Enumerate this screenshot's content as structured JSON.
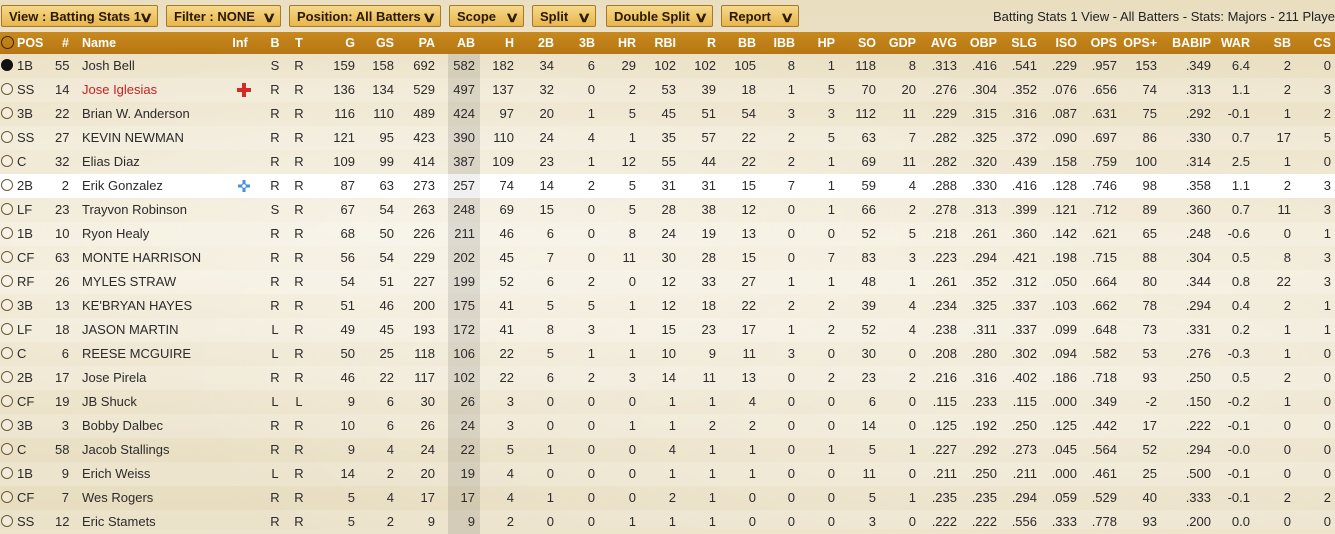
{
  "toolbar": {
    "view_label": "View : Batting Stats 1",
    "filter_label": "Filter : NONE",
    "position_label": "Position: All Batters",
    "scope_label": "Scope",
    "split_label": "Split",
    "double_split_label": "Double Split",
    "report_label": "Report",
    "info_text": "Batting Stats 1 View - All Batters - Stats: Majors - 211 Playe"
  },
  "columns": [
    "POS",
    "#",
    "Name",
    "Inf",
    "B",
    "T",
    "G",
    "GS",
    "PA",
    "AB",
    "H",
    "2B",
    "3B",
    "HR",
    "RBI",
    "R",
    "BB",
    "IBB",
    "HP",
    "SO",
    "GDP",
    "AVG",
    "OBP",
    "SLG",
    "ISO",
    "OPS",
    "OPS+",
    "BABIP",
    "WAR",
    "SB",
    "CS"
  ],
  "colors": {
    "header_bg": "#b97a16",
    "injury_text": "#cc1f1f",
    "injury_icon": "#d42a2a",
    "dtd_icon": "#4a90d9"
  },
  "rows": [
    {
      "selected_radio": true,
      "pos": "1B",
      "num": "55",
      "name": "Josh Bell",
      "inf": "",
      "b": "S",
      "t": "R",
      "g": "159",
      "gs": "158",
      "pa": "692",
      "ab": "582",
      "h": "182",
      "2b": "34",
      "3b": "6",
      "hr": "29",
      "rbi": "102",
      "r": "102",
      "bb": "105",
      "ibb": "8",
      "hp": "1",
      "so": "118",
      "gdp": "8",
      "avg": ".313",
      "obp": ".416",
      "slg": ".541",
      "iso": ".229",
      "ops": ".957",
      "opsp": "153",
      "babip": ".349",
      "war": "6.4",
      "sb": "2",
      "cs": "0"
    },
    {
      "pos": "SS",
      "num": "14",
      "name": "Jose Iglesias",
      "injured": true,
      "inf": "red-cross-icon",
      "b": "R",
      "t": "R",
      "g": "136",
      "gs": "134",
      "pa": "529",
      "ab": "497",
      "h": "137",
      "2b": "32",
      "3b": "0",
      "hr": "2",
      "rbi": "53",
      "r": "39",
      "bb": "18",
      "ibb": "1",
      "hp": "5",
      "so": "70",
      "gdp": "20",
      "avg": ".276",
      "obp": ".304",
      "slg": ".352",
      "iso": ".076",
      "ops": ".656",
      "opsp": "74",
      "babip": ".313",
      "war": "1.1",
      "sb": "2",
      "cs": "3"
    },
    {
      "pos": "3B",
      "num": "22",
      "name": "Brian W. Anderson",
      "inf": "",
      "b": "R",
      "t": "R",
      "g": "116",
      "gs": "110",
      "pa": "489",
      "ab": "424",
      "h": "97",
      "2b": "20",
      "3b": "1",
      "hr": "5",
      "rbi": "45",
      "r": "51",
      "bb": "54",
      "ibb": "3",
      "hp": "3",
      "so": "112",
      "gdp": "11",
      "avg": ".229",
      "obp": ".315",
      "slg": ".316",
      "iso": ".087",
      "ops": ".631",
      "opsp": "75",
      "babip": ".292",
      "war": "-0.1",
      "sb": "1",
      "cs": "2"
    },
    {
      "pos": "SS",
      "num": "27",
      "name": "KEVIN NEWMAN",
      "inf": "",
      "b": "R",
      "t": "R",
      "g": "121",
      "gs": "95",
      "pa": "423",
      "ab": "390",
      "h": "110",
      "2b": "24",
      "3b": "4",
      "hr": "1",
      "rbi": "35",
      "r": "57",
      "bb": "22",
      "ibb": "2",
      "hp": "5",
      "so": "63",
      "gdp": "7",
      "avg": ".282",
      "obp": ".325",
      "slg": ".372",
      "iso": ".090",
      "ops": ".697",
      "opsp": "86",
      "babip": ".330",
      "war": "0.7",
      "sb": "17",
      "cs": "5"
    },
    {
      "pos": "C",
      "num": "32",
      "name": "Elias Diaz",
      "inf": "",
      "b": "R",
      "t": "R",
      "g": "109",
      "gs": "99",
      "pa": "414",
      "ab": "387",
      "h": "109",
      "2b": "23",
      "3b": "1",
      "hr": "12",
      "rbi": "55",
      "r": "44",
      "bb": "22",
      "ibb": "2",
      "hp": "1",
      "so": "69",
      "gdp": "11",
      "avg": ".282",
      "obp": ".320",
      "slg": ".439",
      "iso": ".158",
      "ops": ".759",
      "opsp": "100",
      "babip": ".314",
      "war": "2.5",
      "sb": "1",
      "cs": "0"
    },
    {
      "selected": true,
      "pos": "2B",
      "num": "2",
      "name": "Erik Gonzalez",
      "inf": "blue-cross-icon",
      "b": "R",
      "t": "R",
      "g": "87",
      "gs": "63",
      "pa": "273",
      "ab": "257",
      "h": "74",
      "2b": "14",
      "3b": "2",
      "hr": "5",
      "rbi": "31",
      "r": "31",
      "bb": "15",
      "ibb": "7",
      "hp": "1",
      "so": "59",
      "gdp": "4",
      "avg": ".288",
      "obp": ".330",
      "slg": ".416",
      "iso": ".128",
      "ops": ".746",
      "opsp": "98",
      "babip": ".358",
      "war": "1.1",
      "sb": "2",
      "cs": "3"
    },
    {
      "pos": "LF",
      "num": "23",
      "name": "Trayvon Robinson",
      "inf": "",
      "b": "S",
      "t": "R",
      "g": "67",
      "gs": "54",
      "pa": "263",
      "ab": "248",
      "h": "69",
      "2b": "15",
      "3b": "0",
      "hr": "5",
      "rbi": "28",
      "r": "38",
      "bb": "12",
      "ibb": "0",
      "hp": "1",
      "so": "66",
      "gdp": "2",
      "avg": ".278",
      "obp": ".313",
      "slg": ".399",
      "iso": ".121",
      "ops": ".712",
      "opsp": "89",
      "babip": ".360",
      "war": "0.7",
      "sb": "11",
      "cs": "3"
    },
    {
      "pos": "1B",
      "num": "10",
      "name": "Ryon Healy",
      "inf": "",
      "b": "R",
      "t": "R",
      "g": "68",
      "gs": "50",
      "pa": "226",
      "ab": "211",
      "h": "46",
      "2b": "6",
      "3b": "0",
      "hr": "8",
      "rbi": "24",
      "r": "19",
      "bb": "13",
      "ibb": "0",
      "hp": "0",
      "so": "52",
      "gdp": "5",
      "avg": ".218",
      "obp": ".261",
      "slg": ".360",
      "iso": ".142",
      "ops": ".621",
      "opsp": "65",
      "babip": ".248",
      "war": "-0.6",
      "sb": "0",
      "cs": "1"
    },
    {
      "pos": "CF",
      "num": "63",
      "name": "MONTE HARRISON",
      "inf": "",
      "b": "R",
      "t": "R",
      "g": "56",
      "gs": "54",
      "pa": "229",
      "ab": "202",
      "h": "45",
      "2b": "7",
      "3b": "0",
      "hr": "11",
      "rbi": "30",
      "r": "28",
      "bb": "15",
      "ibb": "0",
      "hp": "7",
      "so": "83",
      "gdp": "3",
      "avg": ".223",
      "obp": ".294",
      "slg": ".421",
      "iso": ".198",
      "ops": ".715",
      "opsp": "88",
      "babip": ".304",
      "war": "0.5",
      "sb": "8",
      "cs": "3"
    },
    {
      "pos": "RF",
      "num": "26",
      "name": "MYLES STRAW",
      "inf": "",
      "b": "R",
      "t": "R",
      "g": "54",
      "gs": "51",
      "pa": "227",
      "ab": "199",
      "h": "52",
      "2b": "6",
      "3b": "2",
      "hr": "0",
      "rbi": "12",
      "r": "33",
      "bb": "27",
      "ibb": "1",
      "hp": "1",
      "so": "48",
      "gdp": "1",
      "avg": ".261",
      "obp": ".352",
      "slg": ".312",
      "iso": ".050",
      "ops": ".664",
      "opsp": "80",
      "babip": ".344",
      "war": "0.8",
      "sb": "22",
      "cs": "3"
    },
    {
      "pos": "3B",
      "num": "13",
      "name": "KE'BRYAN HAYES",
      "inf": "",
      "b": "R",
      "t": "R",
      "g": "51",
      "gs": "46",
      "pa": "200",
      "ab": "175",
      "h": "41",
      "2b": "5",
      "3b": "5",
      "hr": "1",
      "rbi": "12",
      "r": "18",
      "bb": "22",
      "ibb": "2",
      "hp": "2",
      "so": "39",
      "gdp": "4",
      "avg": ".234",
      "obp": ".325",
      "slg": ".337",
      "iso": ".103",
      "ops": ".662",
      "opsp": "78",
      "babip": ".294",
      "war": "0.4",
      "sb": "2",
      "cs": "1"
    },
    {
      "pos": "LF",
      "num": "18",
      "name": "JASON MARTIN",
      "inf": "",
      "b": "L",
      "t": "R",
      "g": "49",
      "gs": "45",
      "pa": "193",
      "ab": "172",
      "h": "41",
      "2b": "8",
      "3b": "3",
      "hr": "1",
      "rbi": "15",
      "r": "23",
      "bb": "17",
      "ibb": "1",
      "hp": "2",
      "so": "52",
      "gdp": "4",
      "avg": ".238",
      "obp": ".311",
      "slg": ".337",
      "iso": ".099",
      "ops": ".648",
      "opsp": "73",
      "babip": ".331",
      "war": "0.2",
      "sb": "1",
      "cs": "1"
    },
    {
      "pos": "C",
      "num": "6",
      "name": "REESE MCGUIRE",
      "inf": "",
      "b": "L",
      "t": "R",
      "g": "50",
      "gs": "25",
      "pa": "118",
      "ab": "106",
      "h": "22",
      "2b": "5",
      "3b": "1",
      "hr": "1",
      "rbi": "10",
      "r": "9",
      "bb": "11",
      "ibb": "3",
      "hp": "0",
      "so": "30",
      "gdp": "0",
      "avg": ".208",
      "obp": ".280",
      "slg": ".302",
      "iso": ".094",
      "ops": ".582",
      "opsp": "53",
      "babip": ".276",
      "war": "-0.3",
      "sb": "1",
      "cs": "0"
    },
    {
      "pos": "2B",
      "num": "17",
      "name": "Jose Pirela",
      "inf": "",
      "b": "R",
      "t": "R",
      "g": "46",
      "gs": "22",
      "pa": "117",
      "ab": "102",
      "h": "22",
      "2b": "6",
      "3b": "2",
      "hr": "3",
      "rbi": "14",
      "r": "11",
      "bb": "13",
      "ibb": "0",
      "hp": "2",
      "so": "23",
      "gdp": "2",
      "avg": ".216",
      "obp": ".316",
      "slg": ".402",
      "iso": ".186",
      "ops": ".718",
      "opsp": "93",
      "babip": ".250",
      "war": "0.5",
      "sb": "2",
      "cs": "0"
    },
    {
      "pos": "CF",
      "num": "19",
      "name": "JB Shuck",
      "inf": "",
      "b": "L",
      "t": "L",
      "g": "9",
      "gs": "6",
      "pa": "30",
      "ab": "26",
      "h": "3",
      "2b": "0",
      "3b": "0",
      "hr": "0",
      "rbi": "1",
      "r": "1",
      "bb": "4",
      "ibb": "0",
      "hp": "0",
      "so": "6",
      "gdp": "0",
      "avg": ".115",
      "obp": ".233",
      "slg": ".115",
      "iso": ".000",
      "ops": ".349",
      "opsp": "-2",
      "babip": ".150",
      "war": "-0.2",
      "sb": "1",
      "cs": "0"
    },
    {
      "pos": "3B",
      "num": "3",
      "name": "Bobby Dalbec",
      "inf": "",
      "b": "R",
      "t": "R",
      "g": "10",
      "gs": "6",
      "pa": "26",
      "ab": "24",
      "h": "3",
      "2b": "0",
      "3b": "0",
      "hr": "1",
      "rbi": "1",
      "r": "2",
      "bb": "2",
      "ibb": "0",
      "hp": "0",
      "so": "14",
      "gdp": "0",
      "avg": ".125",
      "obp": ".192",
      "slg": ".250",
      "iso": ".125",
      "ops": ".442",
      "opsp": "17",
      "babip": ".222",
      "war": "-0.1",
      "sb": "0",
      "cs": "0"
    },
    {
      "pos": "C",
      "num": "58",
      "name": "Jacob Stallings",
      "inf": "",
      "b": "R",
      "t": "R",
      "g": "9",
      "gs": "4",
      "pa": "24",
      "ab": "22",
      "h": "5",
      "2b": "1",
      "3b": "0",
      "hr": "0",
      "rbi": "4",
      "r": "1",
      "bb": "1",
      "ibb": "0",
      "hp": "1",
      "so": "5",
      "gdp": "1",
      "avg": ".227",
      "obp": ".292",
      "slg": ".273",
      "iso": ".045",
      "ops": ".564",
      "opsp": "52",
      "babip": ".294",
      "war": "-0.0",
      "sb": "0",
      "cs": "0"
    },
    {
      "pos": "1B",
      "num": "9",
      "name": "Erich Weiss",
      "inf": "",
      "b": "L",
      "t": "R",
      "g": "14",
      "gs": "2",
      "pa": "20",
      "ab": "19",
      "h": "4",
      "2b": "0",
      "3b": "0",
      "hr": "0",
      "rbi": "1",
      "r": "1",
      "bb": "1",
      "ibb": "0",
      "hp": "0",
      "so": "11",
      "gdp": "0",
      "avg": ".211",
      "obp": ".250",
      "slg": ".211",
      "iso": ".000",
      "ops": ".461",
      "opsp": "25",
      "babip": ".500",
      "war": "-0.1",
      "sb": "0",
      "cs": "0"
    },
    {
      "pos": "CF",
      "num": "7",
      "name": "Wes Rogers",
      "inf": "",
      "b": "R",
      "t": "R",
      "g": "5",
      "gs": "4",
      "pa": "17",
      "ab": "17",
      "h": "4",
      "2b": "1",
      "3b": "0",
      "hr": "0",
      "rbi": "2",
      "r": "1",
      "bb": "0",
      "ibb": "0",
      "hp": "0",
      "so": "5",
      "gdp": "1",
      "avg": ".235",
      "obp": ".235",
      "slg": ".294",
      "iso": ".059",
      "ops": ".529",
      "opsp": "40",
      "babip": ".333",
      "war": "-0.1",
      "sb": "2",
      "cs": "2"
    },
    {
      "pos": "SS",
      "num": "12",
      "name": "Eric Stamets",
      "inf": "",
      "b": "R",
      "t": "R",
      "g": "5",
      "gs": "2",
      "pa": "9",
      "ab": "9",
      "h": "2",
      "2b": "0",
      "3b": "0",
      "hr": "1",
      "rbi": "1",
      "r": "1",
      "bb": "0",
      "ibb": "0",
      "hp": "0",
      "so": "3",
      "gdp": "0",
      "avg": ".222",
      "obp": ".222",
      "slg": ".556",
      "iso": ".333",
      "ops": ".778",
      "opsp": "93",
      "babip": ".200",
      "war": "0.0",
      "sb": "0",
      "cs": "0"
    }
  ]
}
